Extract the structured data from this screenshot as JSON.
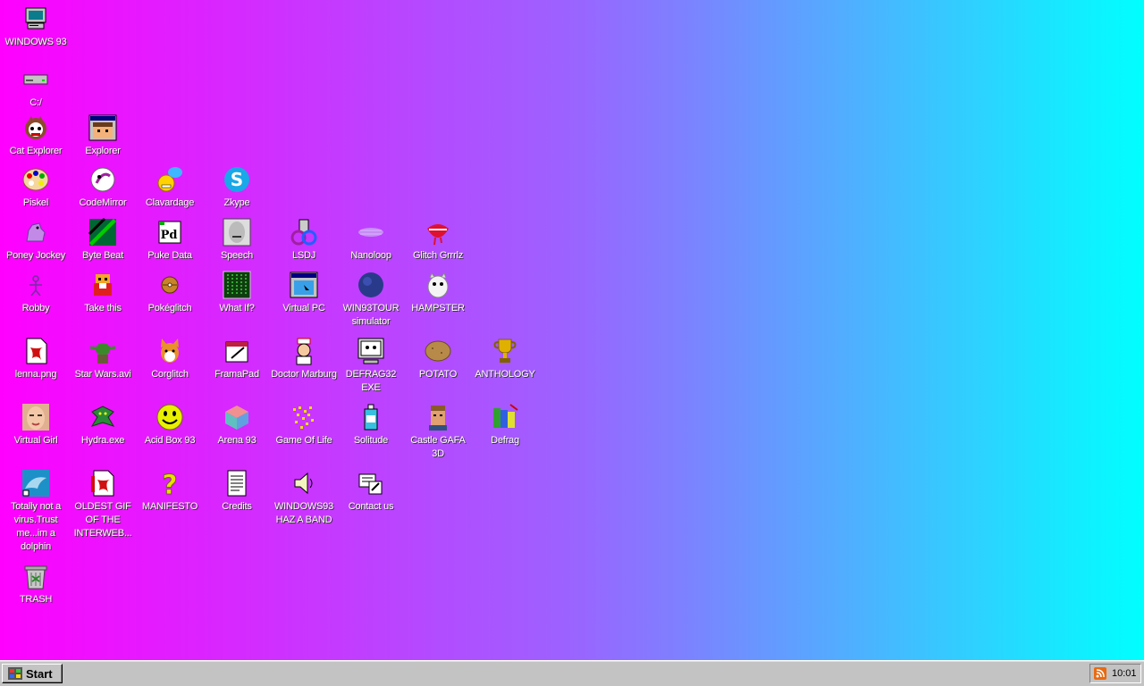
{
  "desktop": {
    "icons": [
      {
        "id": "windows93",
        "label": "WINDOWS 93",
        "icon": "computer-icon"
      },
      {
        "id": "c-drive",
        "label": "C:/",
        "icon": "drive-icon"
      },
      {
        "id": "cat-explorer",
        "label": "Cat Explorer",
        "icon": "cat-icon"
      },
      {
        "id": "explorer",
        "label": "Explorer",
        "icon": "explorer-window-icon"
      },
      {
        "id": "piskel",
        "label": "Piskel",
        "icon": "palette-icon"
      },
      {
        "id": "codemirror",
        "label": "CodeMirror",
        "icon": "codemirror-icon"
      },
      {
        "id": "clavardage",
        "label": "Clavardage",
        "icon": "chat-icon"
      },
      {
        "id": "zkype",
        "label": "Zkype",
        "icon": "zkype-icon"
      },
      {
        "id": "poney-jockey",
        "label": "Poney Jockey",
        "icon": "pony-icon"
      },
      {
        "id": "byte-beat",
        "label": "Byte Beat",
        "icon": "bytebeat-icon"
      },
      {
        "id": "puke-data",
        "label": "Puke Data",
        "icon": "puredata-icon"
      },
      {
        "id": "speech",
        "label": "Speech",
        "icon": "face-icon"
      },
      {
        "id": "lsdj",
        "label": "LSDJ",
        "icon": "gameboy-icon"
      },
      {
        "id": "nanoloop",
        "label": "Nanoloop",
        "icon": "nanoloop-icon"
      },
      {
        "id": "glitch-grrrlz",
        "label": "Glitch Grrrlz",
        "icon": "lips-icon"
      },
      {
        "id": "robby",
        "label": "Robby",
        "icon": "robot-icon"
      },
      {
        "id": "take-this",
        "label": "Take this",
        "icon": "character-icon"
      },
      {
        "id": "pokeglitch",
        "label": "Pokéglitch",
        "icon": "pokeball-icon"
      },
      {
        "id": "what-if",
        "label": "What If?",
        "icon": "matrix-icon"
      },
      {
        "id": "virtual-pc",
        "label": "Virtual PC",
        "icon": "virtual-pc-icon"
      },
      {
        "id": "win93tour",
        "label": "WIN93TOUR simulator",
        "icon": "blob-icon"
      },
      {
        "id": "hampster",
        "label": "HAMPSTER",
        "icon": "hamster-icon"
      },
      {
        "id": "lenna",
        "label": "lenna.png",
        "icon": "image-file-icon"
      },
      {
        "id": "star-wars",
        "label": "Star Wars.avi",
        "icon": "yoda-icon"
      },
      {
        "id": "corglitch",
        "label": "Corglitch",
        "icon": "corgi-icon"
      },
      {
        "id": "framapad",
        "label": "FramaPad",
        "icon": "notepad-icon"
      },
      {
        "id": "doctor-marburg",
        "label": "Doctor Marburg",
        "icon": "doctor-icon"
      },
      {
        "id": "defrag32",
        "label": "DEFRAG32 EXE",
        "icon": "monitor-face-icon"
      },
      {
        "id": "potato",
        "label": "POTATO",
        "icon": "potato-icon"
      },
      {
        "id": "anthology",
        "label": "ANTHOLOGY",
        "icon": "trophy-icon"
      },
      {
        "id": "virtual-girl",
        "label": "Virtual Girl",
        "icon": "girl-face-icon"
      },
      {
        "id": "hydra",
        "label": "Hydra.exe",
        "icon": "hydra-icon"
      },
      {
        "id": "acid-box",
        "label": "Acid Box 93",
        "icon": "smiley-icon"
      },
      {
        "id": "arena93",
        "label": "Arena 93",
        "icon": "cube-icon"
      },
      {
        "id": "game-of-life",
        "label": "Game Of Life",
        "icon": "dots-icon"
      },
      {
        "id": "solitude",
        "label": "Solitude",
        "icon": "bottle-icon"
      },
      {
        "id": "castle-gafa",
        "label": "Castle GAFA 3D",
        "icon": "soldier-icon"
      },
      {
        "id": "defrag",
        "label": "Defrag",
        "icon": "defrag-icon"
      },
      {
        "id": "dolphin",
        "label": "Totally not a virus.Trust me...im a dolphin",
        "icon": "dolphin-icon"
      },
      {
        "id": "oldest-gif",
        "label": "OLDEST GIF OF THE INTERWEB...",
        "icon": "gif-file-icon"
      },
      {
        "id": "manifesto",
        "label": "MANIFESTO",
        "icon": "question-icon"
      },
      {
        "id": "credits",
        "label": "Credits",
        "icon": "document-icon"
      },
      {
        "id": "band",
        "label": "WINDOWS93 HAZ A BAND",
        "icon": "speaker-icon"
      },
      {
        "id": "contact",
        "label": "Contact us",
        "icon": "contact-icon"
      },
      {
        "id": "trash",
        "label": "TRASH",
        "icon": "trash-icon"
      }
    ]
  },
  "taskbar": {
    "start_label": "Start",
    "clock": "10:01",
    "tray_icon": "rss-icon"
  },
  "colors": {
    "gradient_left": "#ff00ff",
    "gradient_mid": "#9b63ff",
    "gradient_right": "#00ffff",
    "taskbar": "#c3c3c3"
  }
}
